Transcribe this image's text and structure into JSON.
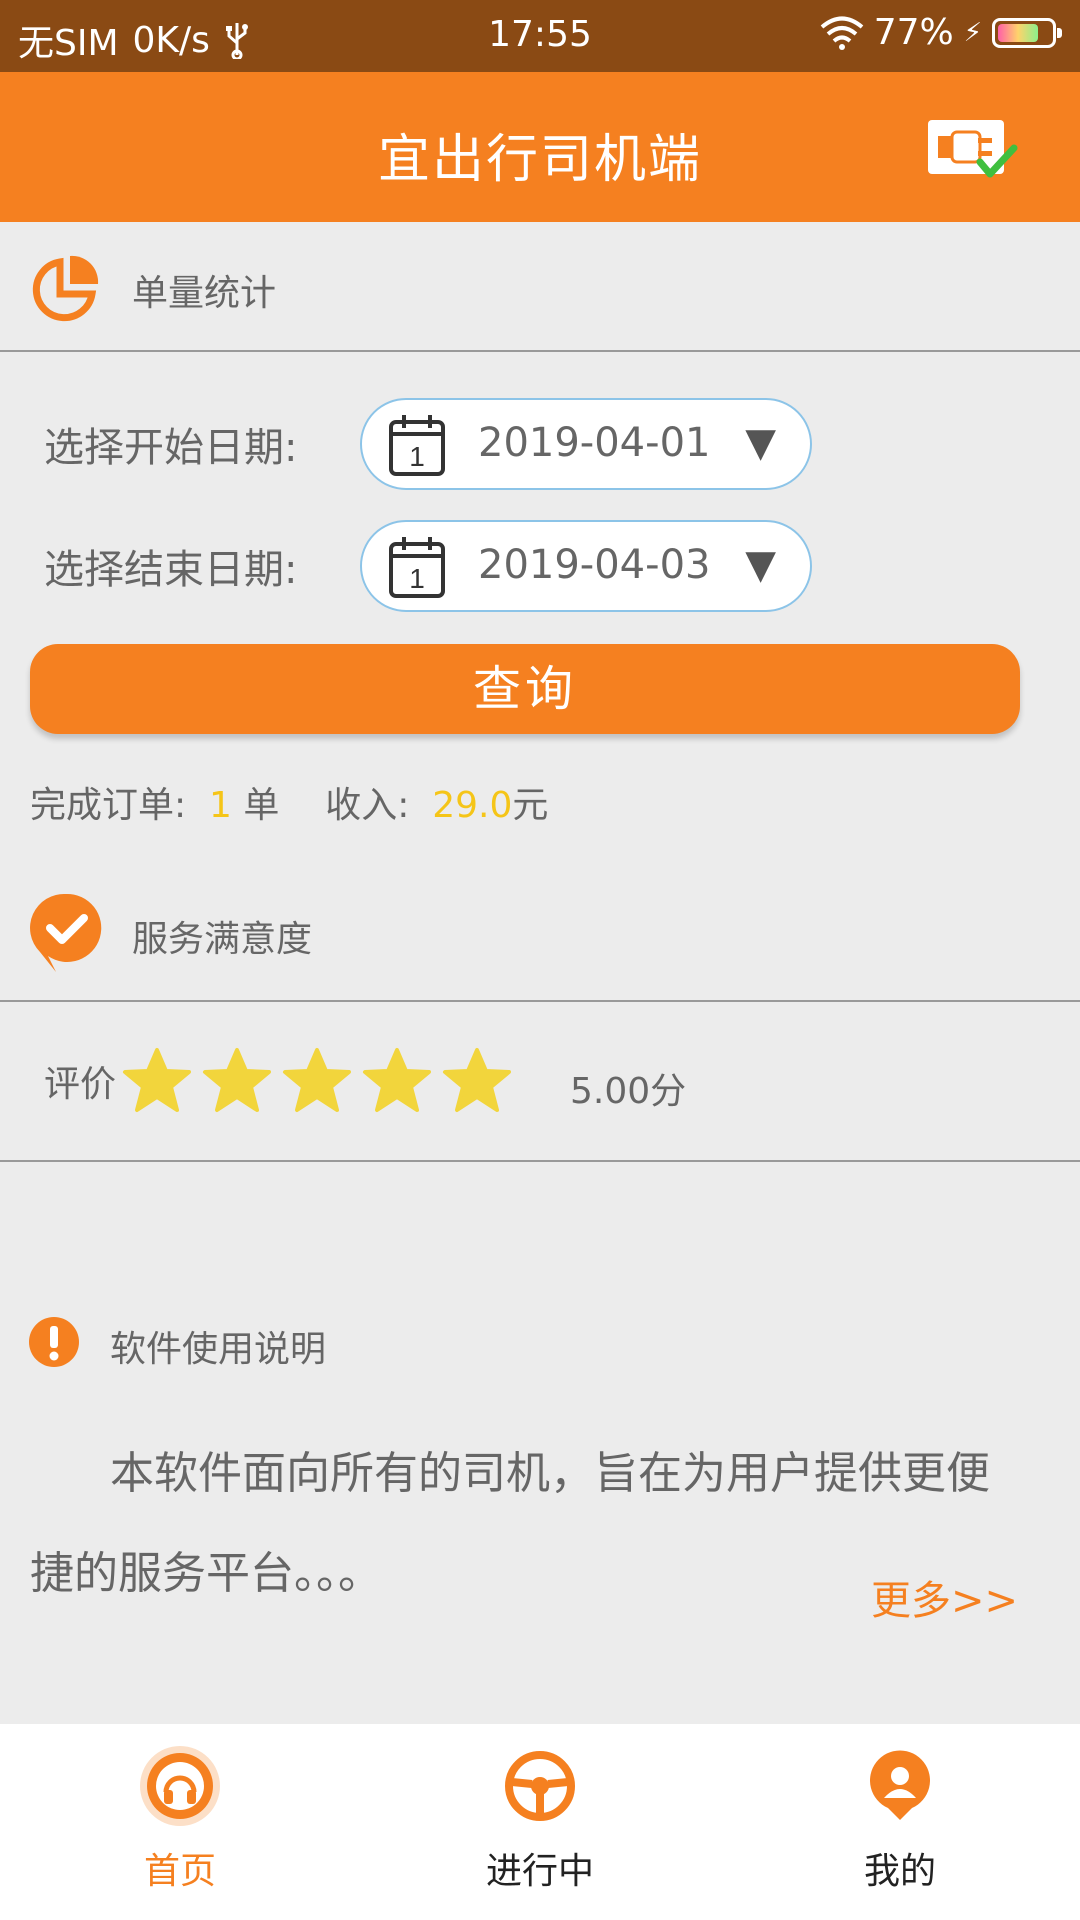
{
  "status_bar": {
    "carrier": "无SIM",
    "speed": "0K/s",
    "time": "17:55",
    "battery": "77%",
    "battery_level": 0.77
  },
  "header": {
    "title": "宜出行司机端"
  },
  "order_stats": {
    "title": "单量统计",
    "start_label": "选择开始日期:",
    "start_value": "2019-04-01",
    "end_label": "选择结束日期:",
    "end_value": "2019-04-03",
    "arrow": "▼",
    "calendar_day": "1",
    "query_label": "查询",
    "done_label": "完成订单:",
    "done_count": "1",
    "done_unit": "单",
    "income_label": "收入:",
    "income_value": "29.0",
    "income_unit": "元"
  },
  "satisfaction": {
    "title": "服务满意度",
    "rating_label": "评价",
    "stars": 5,
    "max_stars": 5,
    "score": "5.00分"
  },
  "instructions": {
    "title": "软件使用说明",
    "text": "本软件面向所有的司机，旨在为用户提供更便捷的服务平台。。。",
    "more": "更多>>"
  },
  "nav": {
    "items": [
      {
        "label": "首页",
        "icon": "home-headset-icon",
        "active": true
      },
      {
        "label": "进行中",
        "icon": "steering-wheel-icon",
        "active": false
      },
      {
        "label": "我的",
        "icon": "user-pin-icon",
        "active": false
      }
    ]
  },
  "colors": {
    "accent": "#f58020",
    "status_bar": "#8a4a14",
    "highlight": "#f5c518",
    "star": "#f2d53c"
  }
}
